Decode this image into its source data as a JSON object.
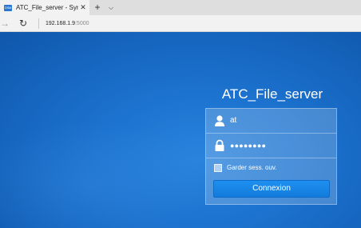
{
  "browser": {
    "tab": {
      "favicon_text": "DSM",
      "title": "ATC_File_server - Synolc",
      "close_symbol": "✕"
    },
    "new_tab_symbol": "+",
    "tab_list_symbol": "⌵",
    "forward_symbol": "→",
    "refresh_symbol": "↻",
    "address": {
      "host": "192.168.1.9",
      "port": ":5000"
    }
  },
  "login": {
    "server_name": "ATC_File_server",
    "username": {
      "icon": "user-icon",
      "value": "at"
    },
    "password": {
      "icon": "lock-icon",
      "masked_value": "●●●●●●●●"
    },
    "remember": {
      "label": "Garder sess. ouv.",
      "checked": false
    },
    "submit_label": "Connexion"
  },
  "colors": {
    "background": "#1566c0",
    "button": "#1a86e8",
    "panel": "rgba(255,255,255,0.2)"
  }
}
